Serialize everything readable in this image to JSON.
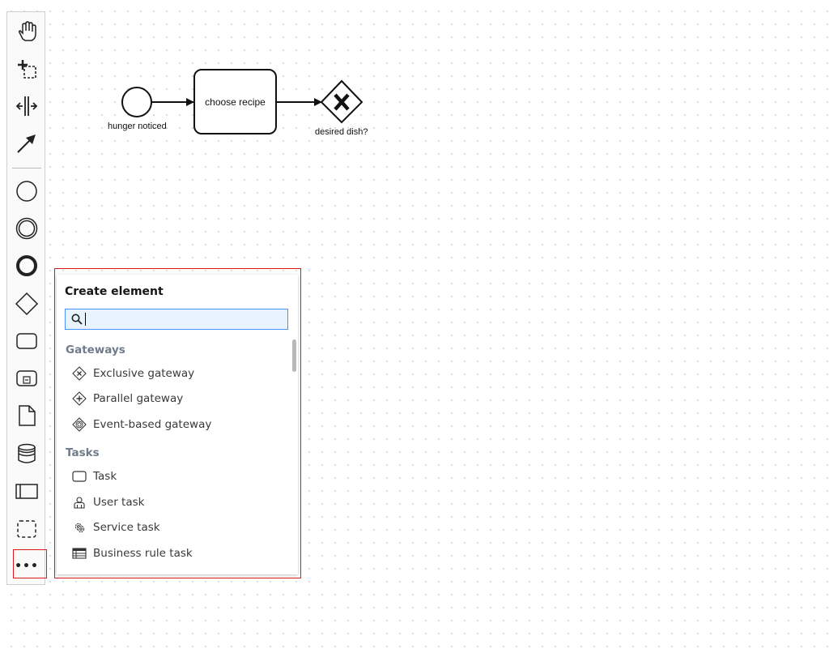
{
  "diagram": {
    "start_event_label": "hunger noticed",
    "task_label": "choose recipe",
    "gateway_label": "desired dish?"
  },
  "palette": {
    "tools": [
      "hand-tool",
      "lasso-tool",
      "space-tool",
      "connect-tool"
    ],
    "shapes": [
      "start-event",
      "intermediate-event",
      "end-event",
      "gateway",
      "task",
      "subprocess",
      "data-object",
      "data-store",
      "participant",
      "group"
    ],
    "more_label": "•••"
  },
  "popup": {
    "title": "Create element",
    "search_value": "",
    "groups": [
      {
        "title": "Gateways",
        "entries": [
          {
            "label": "Exclusive gateway",
            "icon": "exclusive-gateway-icon"
          },
          {
            "label": "Parallel gateway",
            "icon": "parallel-gateway-icon"
          },
          {
            "label": "Event-based gateway",
            "icon": "event-based-gateway-icon"
          }
        ]
      },
      {
        "title": "Tasks",
        "entries": [
          {
            "label": "Task",
            "icon": "task-icon"
          },
          {
            "label": "User task",
            "icon": "user-task-icon"
          },
          {
            "label": "Service task",
            "icon": "service-task-icon"
          },
          {
            "label": "Business rule task",
            "icon": "business-rule-task-icon"
          }
        ]
      }
    ]
  },
  "colors": {
    "highlight": "#e0171d",
    "search_border": "#4d90fe",
    "search_bg": "#e8f3fd",
    "group_title": "#6f7b8a"
  }
}
